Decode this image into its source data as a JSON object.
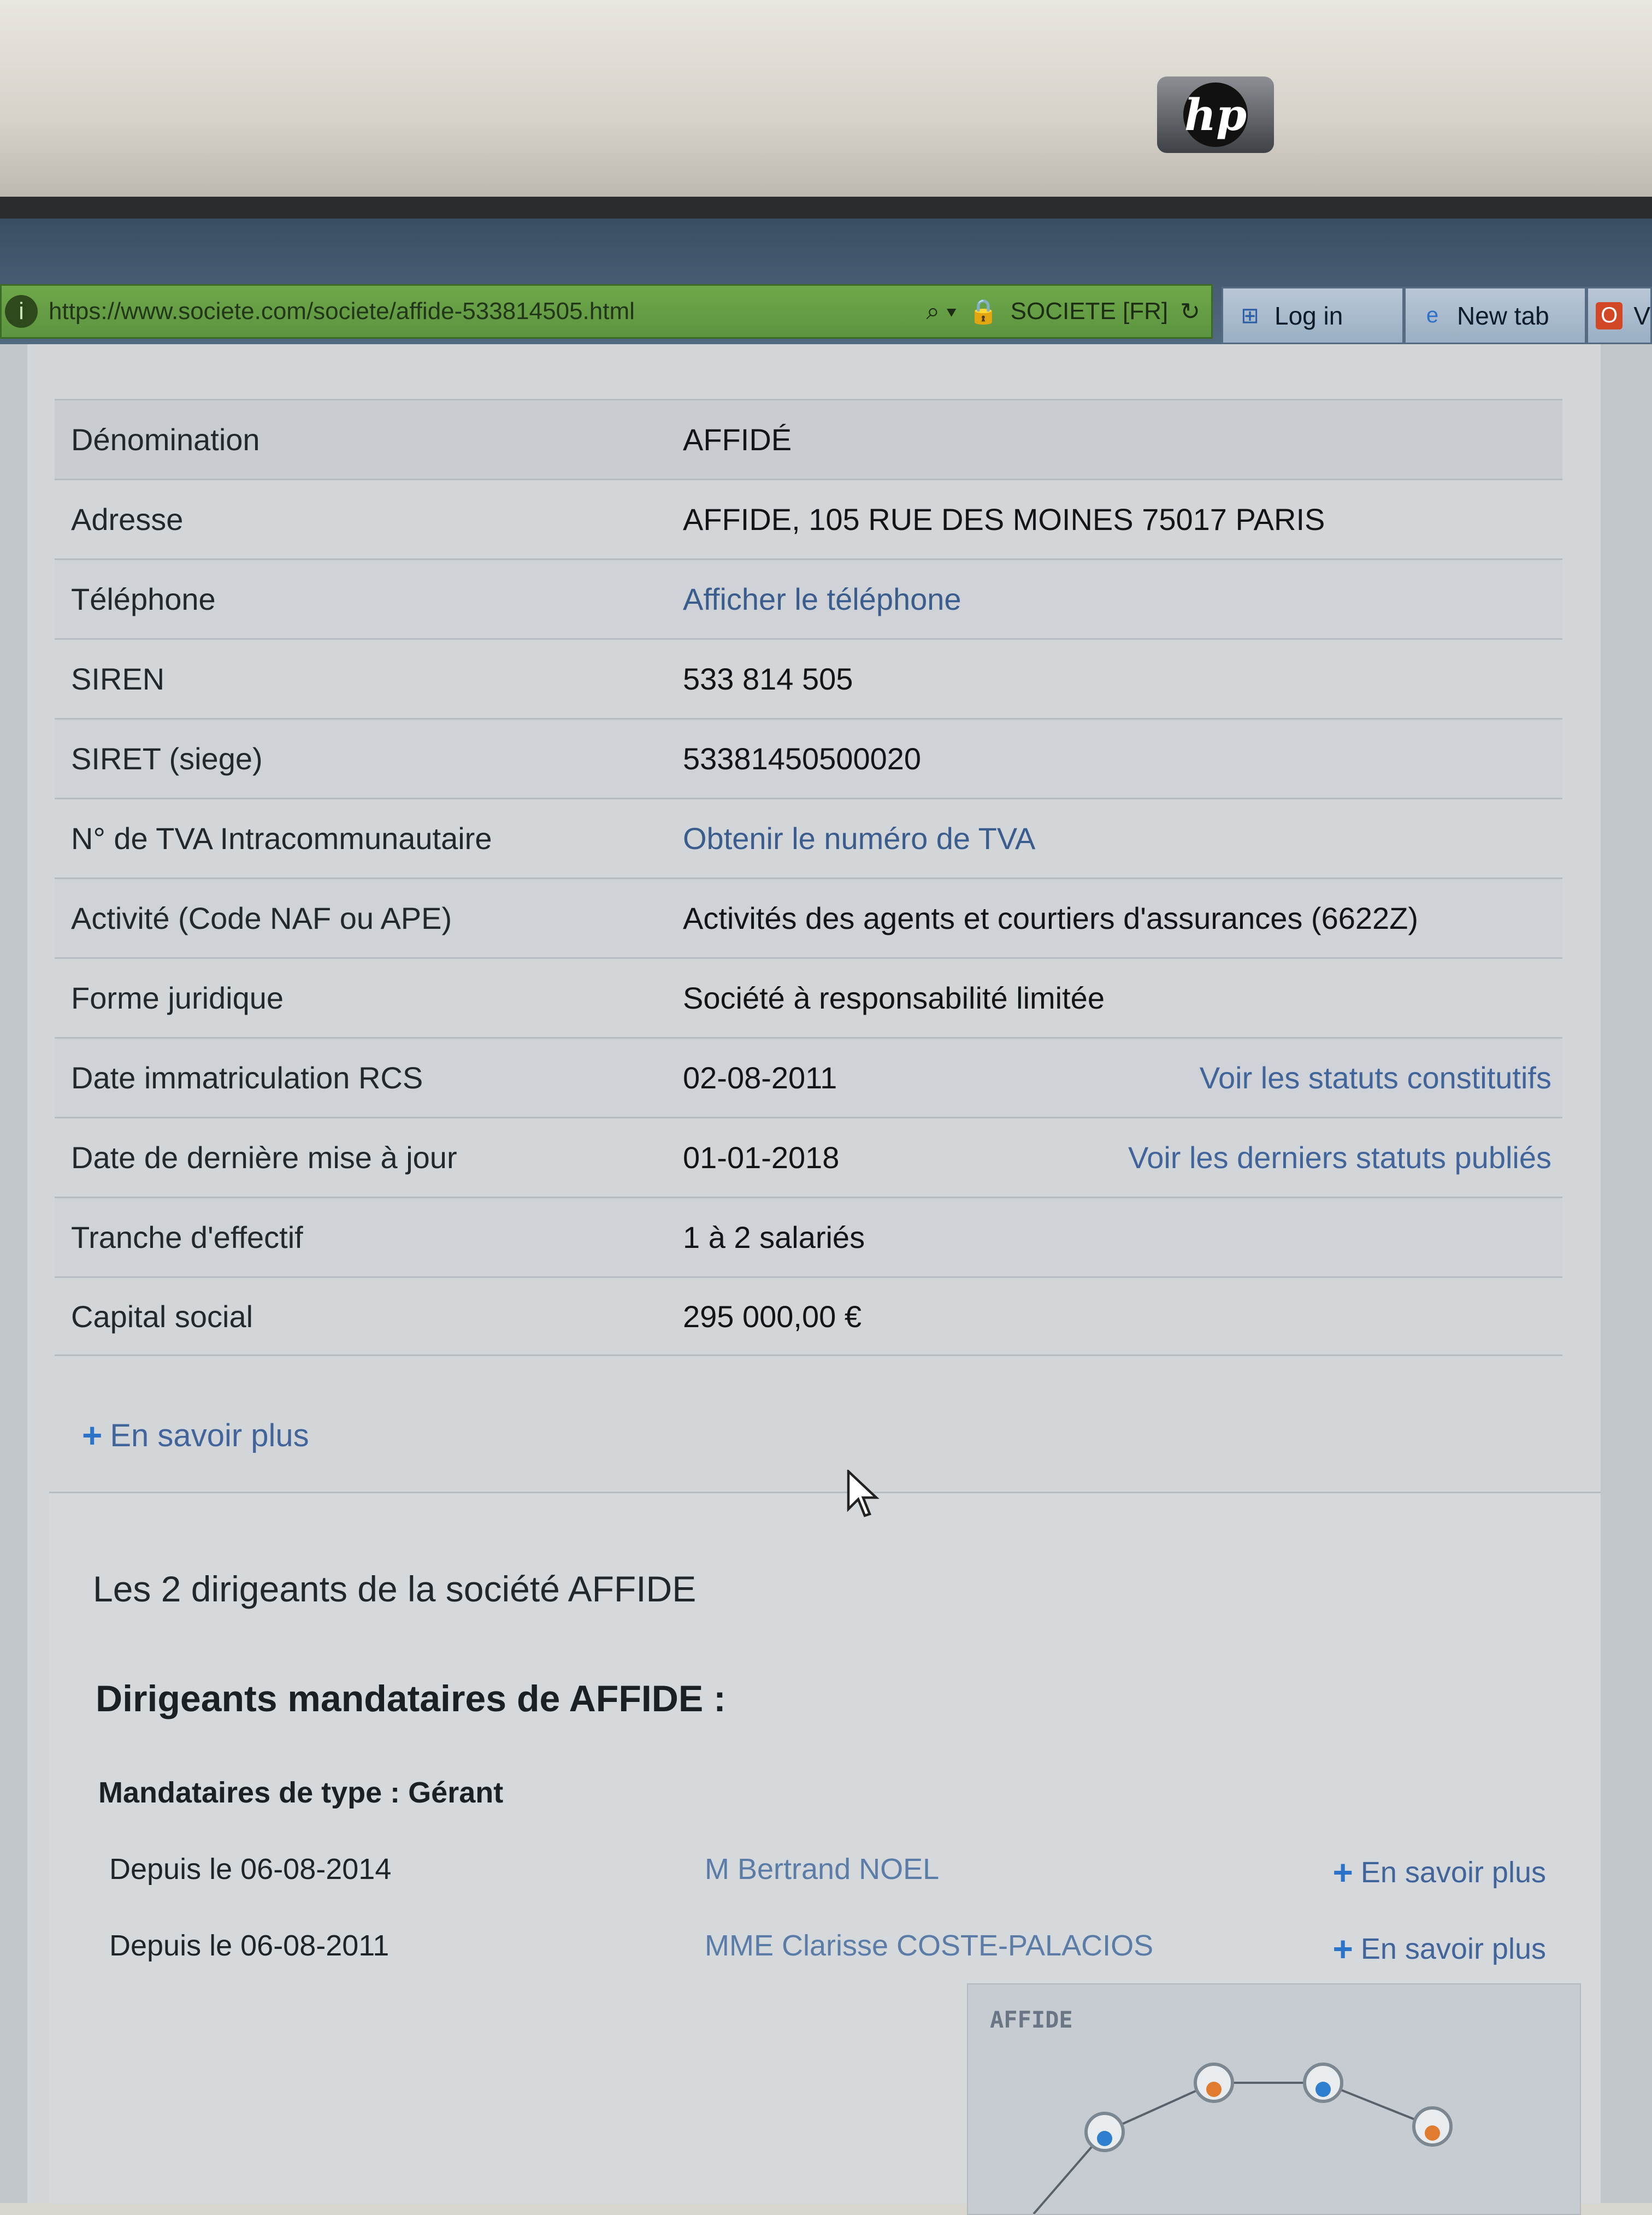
{
  "browser": {
    "url": "https://www.societe.com/societe/affide-533814505.html",
    "site_badge": "SOCIETE [FR]",
    "tabs": [
      {
        "label": "Log in"
      },
      {
        "label": "New tab"
      },
      {
        "label": "V"
      }
    ]
  },
  "company_info": {
    "rows": [
      {
        "label": "Dénomination",
        "value": "AFFIDÉ"
      },
      {
        "label": "Adresse",
        "value": "AFFIDE, 105 RUE DES MOINES 75017 PARIS"
      },
      {
        "label": "Téléphone",
        "value": "Afficher le téléphone"
      },
      {
        "label": "SIREN",
        "value": "533 814 505"
      },
      {
        "label": "SIRET (siege)",
        "value": "53381450500020"
      },
      {
        "label": "N° de TVA Intracommunautaire",
        "value": "Obtenir le numéro de TVA"
      },
      {
        "label": "Activité (Code NAF ou APE)",
        "value": "Activités des agents et courtiers d'assurances (6622Z)"
      },
      {
        "label": "Forme juridique",
        "value": "Société à responsabilité limitée"
      },
      {
        "label": "Date immatriculation RCS",
        "value": "02-08-2011",
        "extra": "Voir les statuts constitutifs"
      },
      {
        "label": "Date de dernière mise à jour",
        "value": "01-01-2018",
        "extra": "Voir les derniers statuts publiés"
      },
      {
        "label": "Tranche d'effectif",
        "value": "1 à 2 salariés"
      },
      {
        "label": "Capital social",
        "value": "295 000,00 €"
      }
    ],
    "more_label": "En savoir plus"
  },
  "directors": {
    "title": "Les 2 dirigeants de la société AFFIDE",
    "subtitle": "Dirigeants mandataires de AFFIDE :",
    "type_label": "Mandataires de type : Gérant",
    "items": [
      {
        "since": "Depuis le 06-08-2014",
        "name": "M Bertrand NOEL",
        "more": "En savoir plus"
      },
      {
        "since": "Depuis le 06-08-2011",
        "name": "MME Clarisse COSTE-PALACIOS",
        "more": "En savoir plus"
      }
    ]
  },
  "graph": {
    "label": "AFFIDE"
  },
  "colors": {
    "link": "#41659a",
    "plus": "#2a73c8",
    "address_bar": "#6fa84a"
  }
}
